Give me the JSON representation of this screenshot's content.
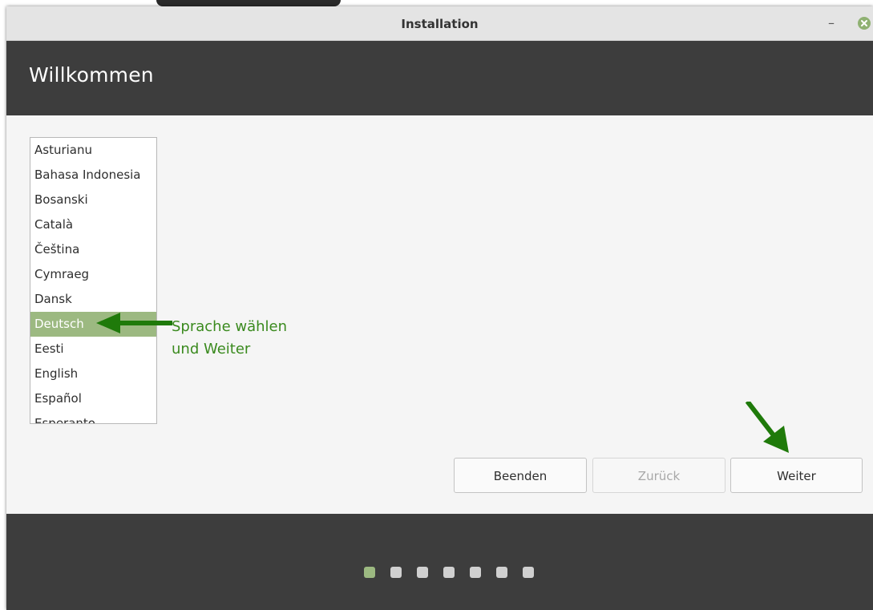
{
  "window": {
    "title": "Installation",
    "minimize_glyph": "–"
  },
  "header": {
    "heading": "Willkommen"
  },
  "language_list": {
    "items": [
      {
        "label": "Asturianu"
      },
      {
        "label": "Bahasa Indonesia"
      },
      {
        "label": "Bosanski"
      },
      {
        "label": "Català"
      },
      {
        "label": "Čeština"
      },
      {
        "label": "Cymraeg"
      },
      {
        "label": "Dansk"
      },
      {
        "label": "Deutsch"
      },
      {
        "label": "Eesti"
      },
      {
        "label": "English"
      },
      {
        "label": "Español"
      },
      {
        "label": "Esperanto"
      }
    ],
    "selected": "Deutsch"
  },
  "annotation": {
    "line1": "Sprache wählen",
    "line2": "und Weiter",
    "color": "#3a8a1e"
  },
  "buttons": {
    "quit": "Beenden",
    "back": "Zurück",
    "next": "Weiter"
  },
  "progress": {
    "total_steps": 7,
    "current_step": 1
  },
  "colors": {
    "accent": "#9cb981",
    "header_bg": "#3d3d3d",
    "annotation_arrow": "#1f7a0a"
  },
  "icons": {
    "close": "close-icon",
    "minimize": "minimize-icon",
    "annotation_left_arrow": "arrow-left-icon",
    "annotation_down_arrow": "arrow-down-icon"
  }
}
